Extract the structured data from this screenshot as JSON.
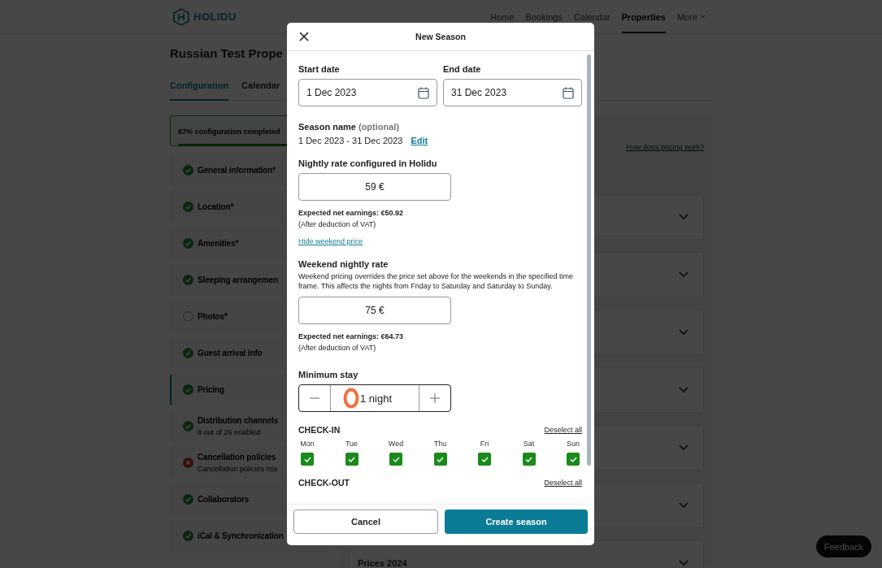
{
  "header": {
    "logo": "HOLIDU",
    "nav": [
      {
        "label": "Home",
        "selected": false,
        "kind": "link"
      },
      {
        "label": "Bookings",
        "selected": false,
        "kind": "link"
      },
      {
        "label": "Calendar",
        "selected": false,
        "kind": "link"
      },
      {
        "label": "Properties",
        "selected": true,
        "kind": "link"
      },
      {
        "label": "More",
        "selected": false,
        "kind": "menu"
      }
    ]
  },
  "property": {
    "title": "Russian Test Prope",
    "tabs": [
      {
        "label": "Configuration",
        "selected": true
      },
      {
        "label": "Calendar",
        "selected": false
      }
    ]
  },
  "progress": {
    "label": "87% configuration completed",
    "level": 0.87
  },
  "sidebar": {
    "items": [
      {
        "label": "General information*",
        "kind": "done",
        "selected": false
      },
      {
        "label": "Location*",
        "kind": "done",
        "selected": false
      },
      {
        "label": "Amenities*",
        "kind": "done",
        "selected": false
      },
      {
        "label": "Sleeping arrangemen",
        "kind": "done",
        "selected": false
      },
      {
        "label": "Photos*",
        "kind": "empty",
        "selected": false
      },
      {
        "label": "Guest arrival info",
        "kind": "done",
        "selected": false
      },
      {
        "label": "Pricing",
        "kind": "done",
        "selected": true
      },
      {
        "label": "Distribution channels",
        "subtitle": "8 out of 26 enabled",
        "kind": "done",
        "selected": false
      },
      {
        "label": "Cancellation policies",
        "subtitle": "Cancellation policies mis",
        "kind": "error",
        "selected": false
      },
      {
        "label": "Collaborators",
        "kind": "done",
        "selected": false
      },
      {
        "label": "iCal & Synchronization",
        "kind": "done",
        "selected": false
      }
    ]
  },
  "pricing": {
    "help_link": "How does pricing work?",
    "sections": [
      {
        "expanded": false
      },
      {
        "expanded": false
      },
      {
        "expanded": false
      },
      {
        "expanded": false
      },
      {
        "expanded": false
      },
      {
        "expanded": false
      },
      {
        "title": "Prices 2024",
        "expanded": false
      }
    ]
  },
  "feedback": "Feedback",
  "modal": {
    "title": "New Season",
    "start_date": {
      "label": "Start date",
      "value": "1 Dec 2023"
    },
    "end_date": {
      "label": "End date",
      "value": "31 Dec 2023"
    },
    "season_name": {
      "label": "Season name",
      "optional": "(optional)",
      "value": "1 Dec 2023 - 31 Dec 2023",
      "edit": "Edit"
    },
    "nightly_rate": {
      "label": "Nightly rate configured in Holidu",
      "value": "59 €",
      "earnings": "Expected net earnings: €50.92",
      "vat_note": "(After deduction of VAT)",
      "link": "Hide weekend price"
    },
    "weekend_rate": {
      "label": "Weekend nightly rate",
      "description": "Weekend pricing overrides the price set above for the weekends in the specified time frame. This affects the nights from Friday to Saturday and Saturday to Sunday.",
      "value": "75 €",
      "earnings": "Expected net earnings: €64.73",
      "vat_note": "(After deduction of VAT)"
    },
    "minimum_stay": {
      "label": "Minimum stay",
      "value": "1 night"
    },
    "check_in": {
      "title": "CHECK-IN",
      "deselect": "Deselect all",
      "days": [
        {
          "label": "Mon",
          "checked": true
        },
        {
          "label": "Tue",
          "checked": true
        },
        {
          "label": "Wed",
          "checked": true
        },
        {
          "label": "Thu",
          "checked": true
        },
        {
          "label": "Fri",
          "checked": true
        },
        {
          "label": "Sat",
          "checked": true
        },
        {
          "label": "Sun",
          "checked": true
        }
      ]
    },
    "check_out": {
      "title": "CHECK-OUT",
      "deselect": "Deselect all"
    },
    "buttons": {
      "cancel": "Cancel",
      "create": "Create season"
    }
  }
}
